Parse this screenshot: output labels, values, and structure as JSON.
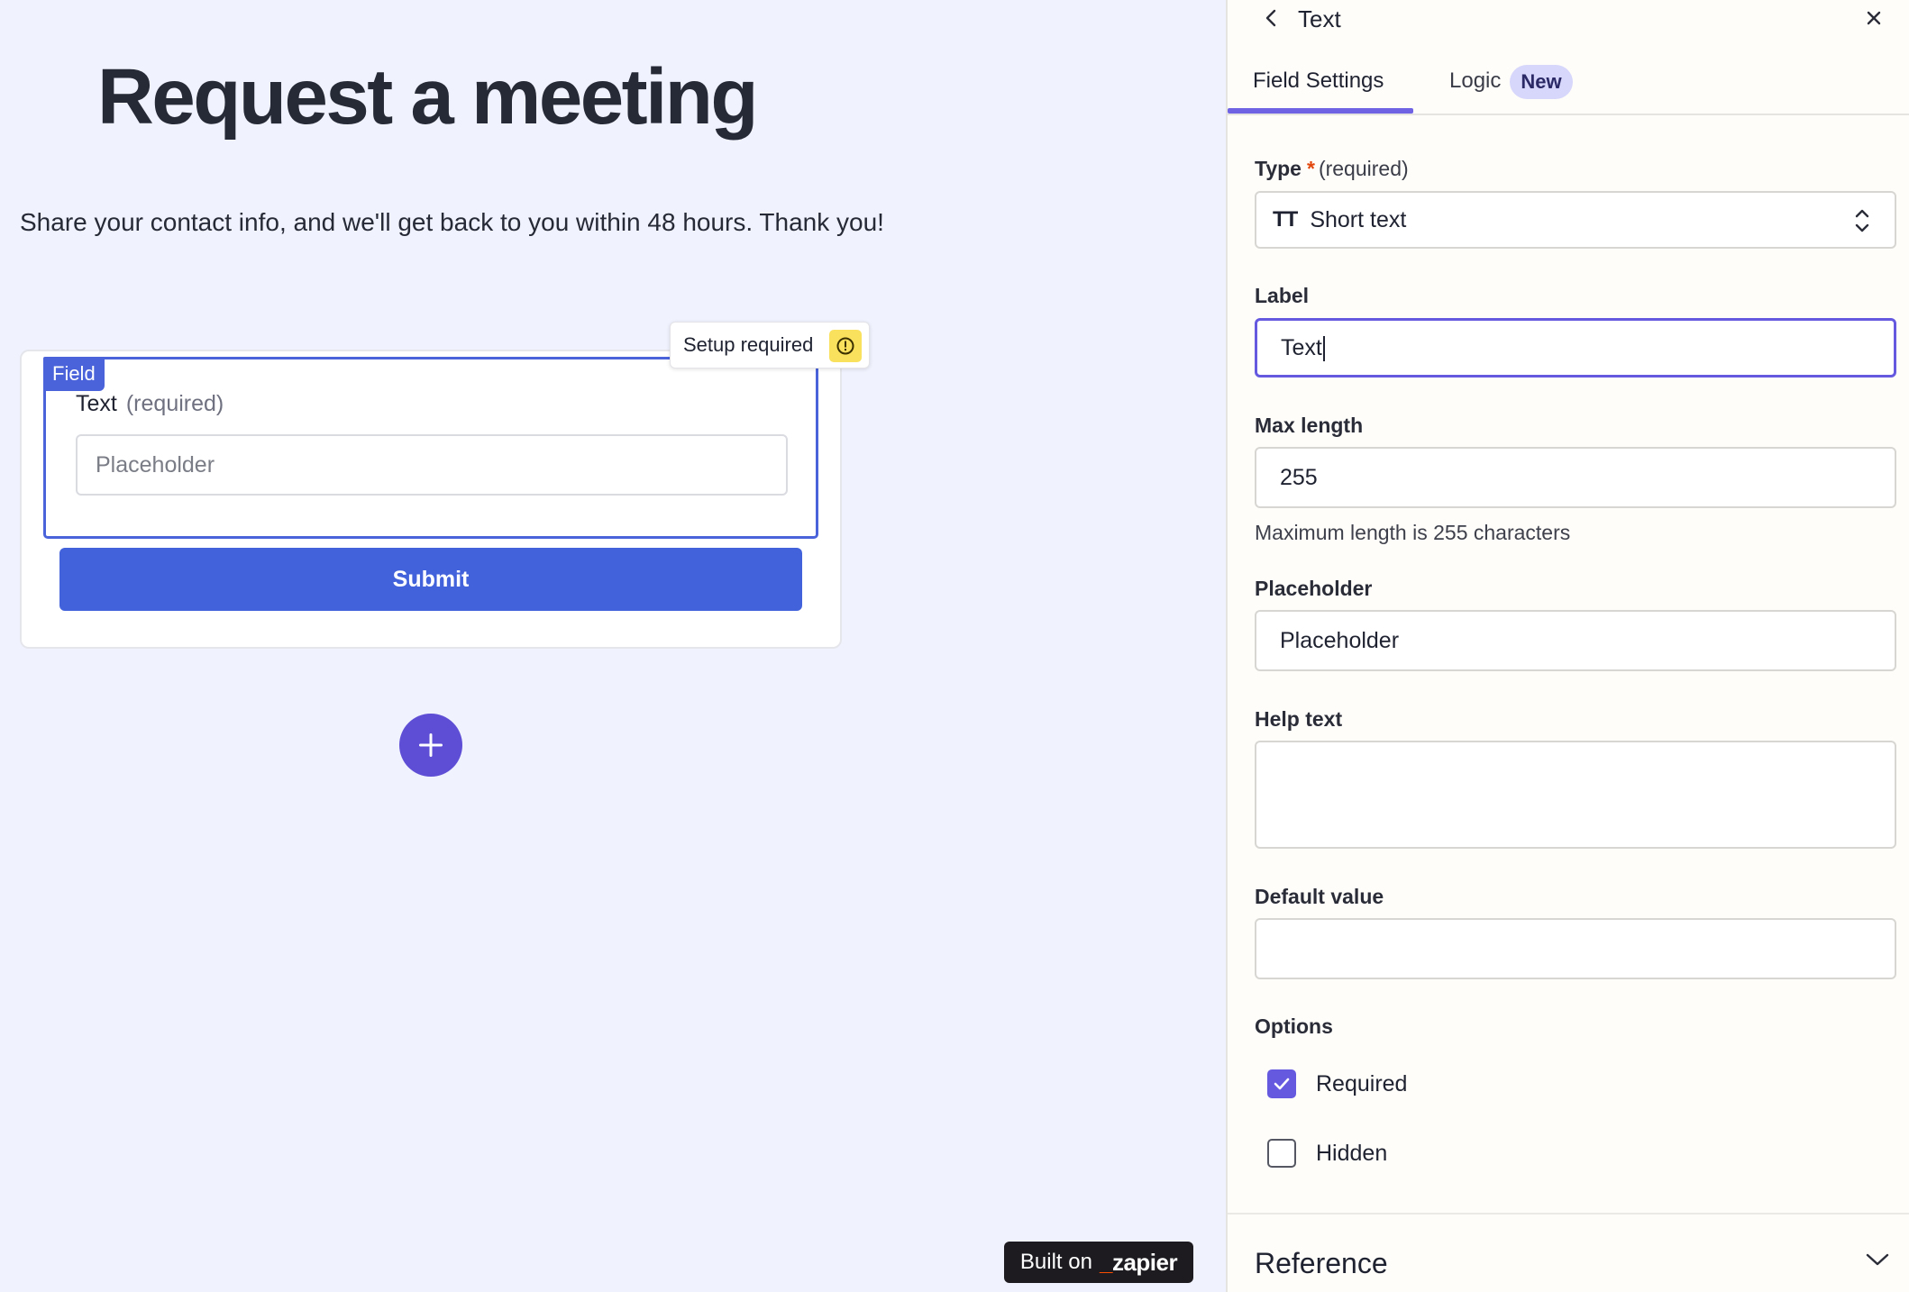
{
  "form": {
    "title": "Request a meeting",
    "description": "Share your contact info, and we'll get back to you within 48 hours. Thank you!",
    "field_tag": "Field",
    "setup_required": "Setup required",
    "field_label": "Text",
    "field_required": "(required)",
    "field_placeholder": "Placeholder",
    "submit_label": "Submit"
  },
  "footer": {
    "built_on": "Built on",
    "brand": "zapier",
    "brand_mark": "_"
  },
  "panel": {
    "title": "Text",
    "tabs": [
      {
        "label": "Field Settings",
        "active": true
      },
      {
        "label": "Logic",
        "badge": "New",
        "active": false
      }
    ],
    "type": {
      "label": "Type",
      "required_mark": "*",
      "required_text": "(required)",
      "icon_glyph": "TT",
      "value": "Short text"
    },
    "label_field": {
      "label": "Label",
      "value": "Text"
    },
    "max_length": {
      "label": "Max length",
      "value": "255",
      "hint": "Maximum length is 255 characters"
    },
    "placeholder": {
      "label": "Placeholder",
      "value": "Placeholder"
    },
    "help_text": {
      "label": "Help text",
      "value": ""
    },
    "default_value": {
      "label": "Default value",
      "value": ""
    },
    "options": {
      "label": "Options",
      "items": [
        {
          "label": "Required",
          "checked": true
        },
        {
          "label": "Hidden",
          "checked": false
        }
      ]
    },
    "reference": {
      "label": "Reference"
    }
  },
  "colors": {
    "canvas_bg": "#f0f2fd",
    "primary_blue": "#4262dc",
    "accent_purple": "#6559e0",
    "warning_yellow": "#f9e15e",
    "badge_bg": "#d7d6fb",
    "brand_orange": "#ff4f00"
  },
  "icons": {
    "back": "chevron-left-icon",
    "close": "close-icon",
    "warning": "warning-circle-icon",
    "add": "plus-icon",
    "select": "chevron-up-down-icon",
    "check": "check-icon",
    "expand": "chevron-down-icon"
  }
}
